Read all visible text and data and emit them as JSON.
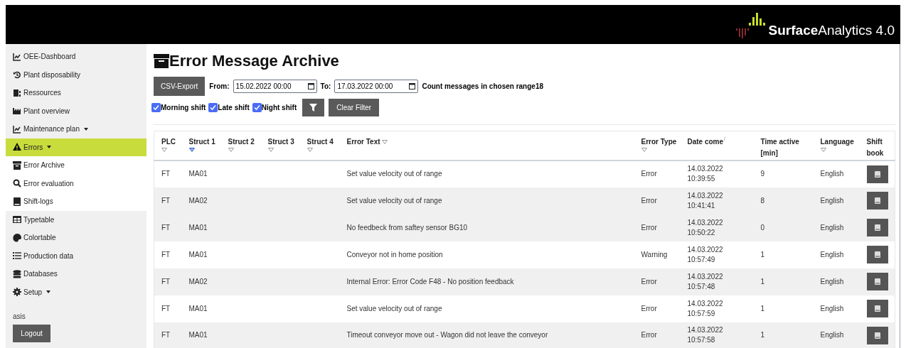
{
  "brand": {
    "name_bold": "Surface",
    "name_rest": "Analytics 4.0"
  },
  "sidebar": {
    "items": [
      {
        "label": "OEE-Dashboard",
        "selected": false,
        "dropdown": false
      },
      {
        "label": "Plant disposability",
        "selected": false,
        "dropdown": false
      },
      {
        "label": "Ressources",
        "selected": false,
        "dropdown": false
      },
      {
        "label": "Plant overview",
        "selected": false,
        "dropdown": false
      },
      {
        "label": "Maintenance plan",
        "selected": false,
        "dropdown": true
      },
      {
        "label": "Errors",
        "selected": true,
        "dropdown": true,
        "children": [
          {
            "label": "Error Archive"
          },
          {
            "label": "Error evaluation"
          },
          {
            "label": "Shift-logs"
          }
        ]
      },
      {
        "label": "Typetable",
        "selected": false,
        "dropdown": false
      },
      {
        "label": "Colortable",
        "selected": false,
        "dropdown": false
      },
      {
        "label": "Production data",
        "selected": false,
        "dropdown": false
      },
      {
        "label": "Databases",
        "selected": false,
        "dropdown": false
      },
      {
        "label": "Setup",
        "selected": false,
        "dropdown": true
      }
    ],
    "user": "asis",
    "logout": "Logout"
  },
  "page": {
    "title": "Error Message Archive",
    "csv_export": "CSV-Export",
    "from_label": "From:",
    "from_value": "15.02.2022 00:00",
    "to_label": "To:",
    "to_value": "17.03.2022 00:00",
    "count_text": "Count messages in chosen range18",
    "shifts": [
      {
        "label": "Morning shift",
        "checked": true
      },
      {
        "label": "Late shift",
        "checked": true
      },
      {
        "label": "Night shift",
        "checked": true
      }
    ],
    "clear_filter": "Clear Filter"
  },
  "table": {
    "columns": [
      {
        "label": "PLC",
        "filter": true,
        "filter_active": false
      },
      {
        "label": "Struct 1",
        "filter": true,
        "filter_active": true
      },
      {
        "label": "Struct 2",
        "filter": true,
        "filter_active": false
      },
      {
        "label": "Struct 3",
        "filter": true,
        "filter_active": false
      },
      {
        "label": "Struct 4",
        "filter": true,
        "filter_active": false
      },
      {
        "label": "Error Text",
        "filter": true,
        "filter_active": false,
        "inline": true
      },
      {
        "label": "Error Type",
        "filter": true,
        "filter_active": false
      },
      {
        "label": "Date come",
        "filter": false,
        "sortable": true
      },
      {
        "label": "Time active [min]",
        "filter": false,
        "sortable": false
      },
      {
        "label": "Language",
        "filter": true,
        "filter_active": false
      },
      {
        "label": "Shift book",
        "filter": false,
        "sortable": false
      }
    ],
    "rows": [
      {
        "shaded": false,
        "cells": [
          "FT",
          "MA01",
          "",
          "",
          "",
          "Set value velocity out of range",
          "Error",
          "14.03.2022 10:39:55",
          "9",
          "English"
        ]
      },
      {
        "shaded": true,
        "cells": [
          "FT",
          "MA02",
          "",
          "",
          "",
          "Set value velocity out of range",
          "Error",
          "14.03.2022 10:41:41",
          "8",
          "English"
        ]
      },
      {
        "shaded": true,
        "cells": [
          "FT",
          "MA01",
          "",
          "",
          "",
          "No feedbeck from saftey sensor BG10",
          "Error",
          "14.03.2022 10:50:22",
          "0",
          "English"
        ]
      },
      {
        "shaded": false,
        "cells": [
          "FT",
          "MA01",
          "",
          "",
          "",
          "Conveyor not in home position",
          "Warning",
          "14.03.2022 10:57:49",
          "1",
          "English"
        ]
      },
      {
        "shaded": true,
        "cells": [
          "FT",
          "MA02",
          "",
          "",
          "",
          "Internal Error: Error Code F48 - No position feedback",
          "Error",
          "14.03.2022 10:57:48",
          "1",
          "English"
        ]
      },
      {
        "shaded": false,
        "cells": [
          "FT",
          "MA01",
          "",
          "",
          "",
          "Set value velocity out of range",
          "Error",
          "14.03.2022 10:57:59",
          "1",
          "English"
        ]
      },
      {
        "shaded": true,
        "cells": [
          "FT",
          "MA01",
          "",
          "",
          "",
          "Timeout conveyor move out - Wagon did not leave the conveyor",
          "Error",
          "14.03.2022 10:57:58",
          "1",
          "English"
        ]
      }
    ]
  }
}
